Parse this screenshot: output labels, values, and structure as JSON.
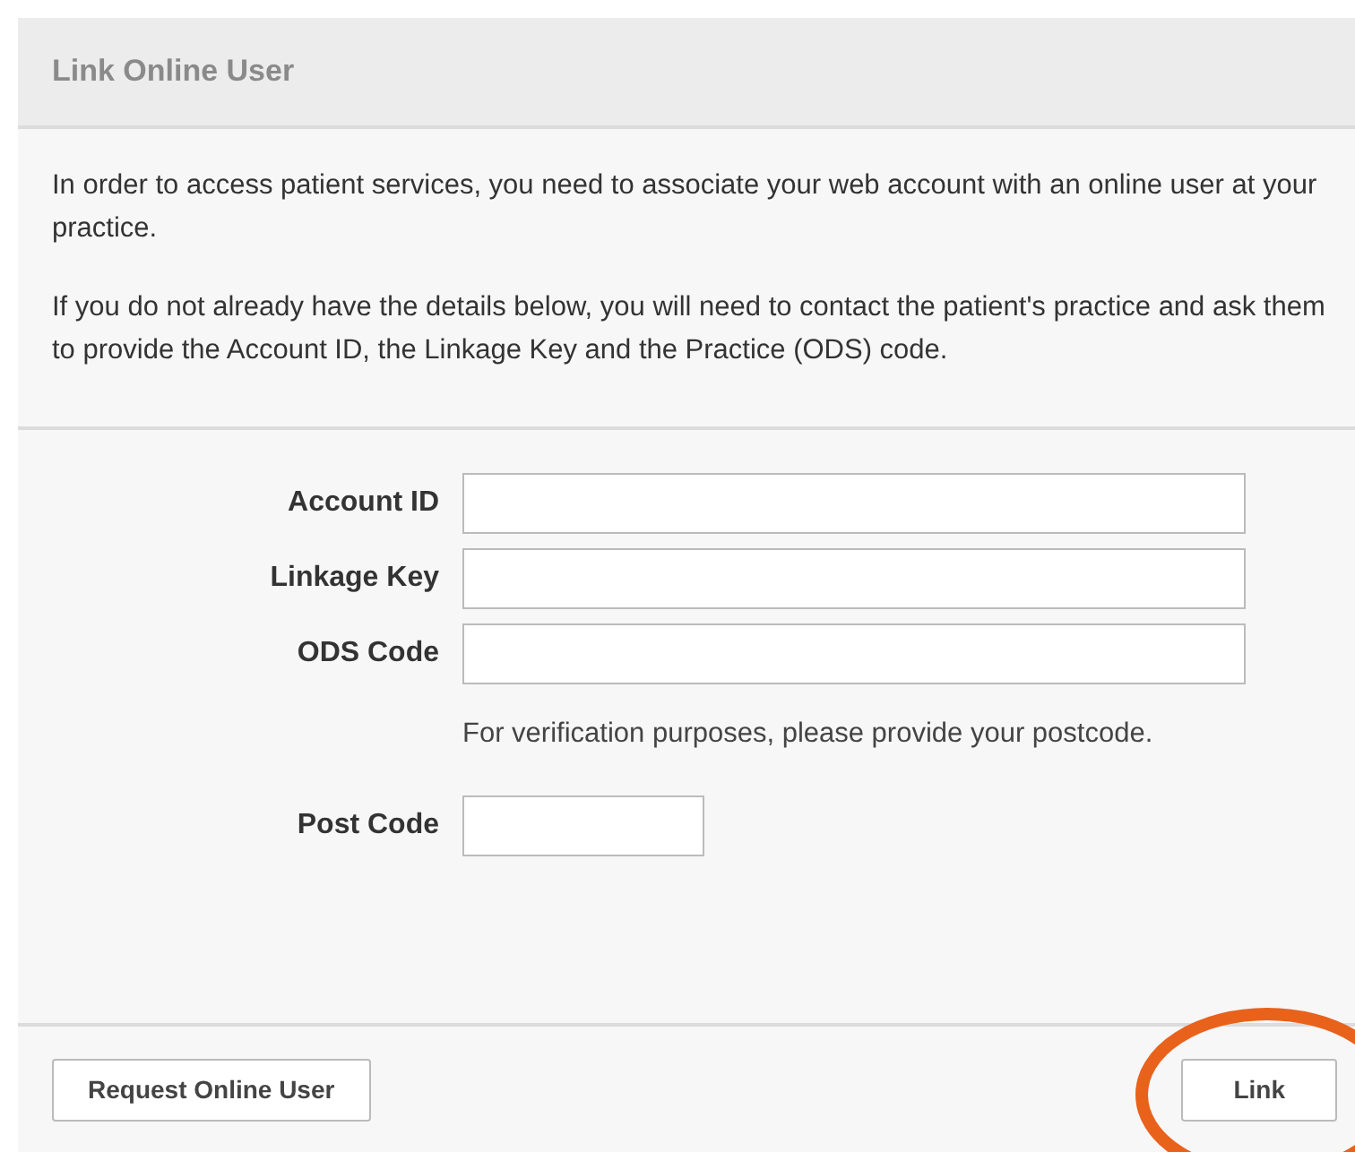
{
  "panel": {
    "title": "Link Online User"
  },
  "intro": [
    "In order to access patient services, you need to associate your web account with an online user at your practice.",
    "If you do not already have the details below, you will need to contact the patient's practice and ask them to provide the Account ID, the Linkage Key and the Practice (ODS) code."
  ],
  "form": [
    {
      "kind": "wide",
      "label": "Account ID"
    },
    {
      "kind": "wide",
      "label": "Linkage Key"
    },
    {
      "kind": "wide",
      "label": "ODS Code"
    },
    {
      "kind": "note",
      "text": "For verification purposes, please provide your postcode."
    },
    {
      "kind": "short",
      "label": "Post Code"
    }
  ],
  "buttons": [
    {
      "label": "Request Online User",
      "highlighted": false
    },
    {
      "label": "Link",
      "highlighted": true
    }
  ]
}
